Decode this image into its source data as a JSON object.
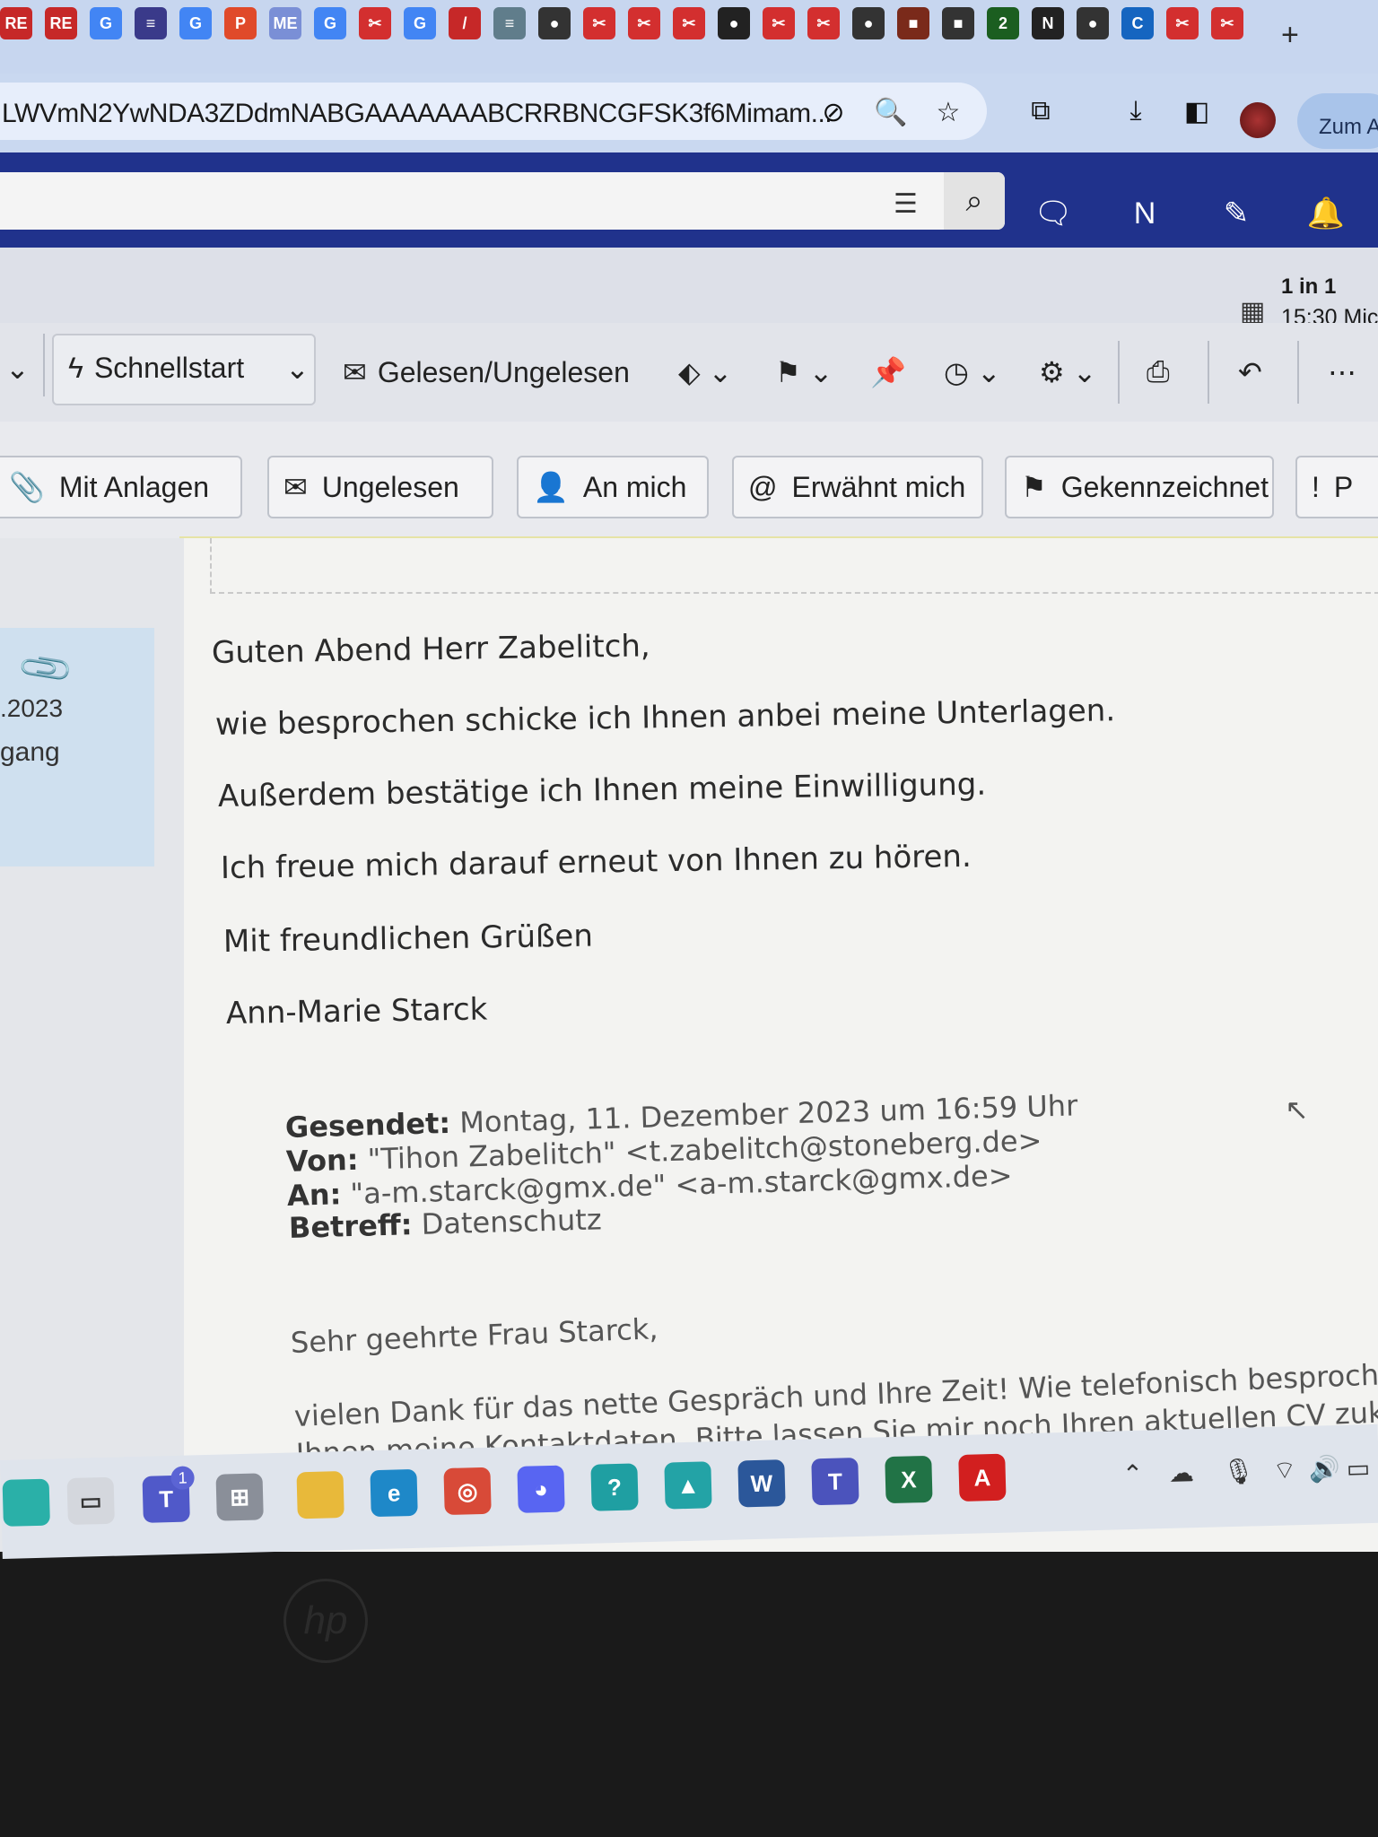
{
  "browser": {
    "tab_icons": [
      {
        "label": "RE",
        "color": "#c62828"
      },
      {
        "label": "RE",
        "color": "#c62828"
      },
      {
        "label": "G",
        "color": "#4285f4"
      },
      {
        "label": "≡",
        "color": "#3a3a8a"
      },
      {
        "label": "G",
        "color": "#4285f4"
      },
      {
        "label": "P",
        "color": "#e04a2a"
      },
      {
        "label": "ME",
        "color": "#7a8fd6"
      },
      {
        "label": "G",
        "color": "#4285f4"
      },
      {
        "label": "✂",
        "color": "#d32f2f"
      },
      {
        "label": "G",
        "color": "#4285f4"
      },
      {
        "label": "/",
        "color": "#c62828"
      },
      {
        "label": "≡",
        "color": "#607d8b"
      },
      {
        "label": "●",
        "color": "#333333"
      },
      {
        "label": "✂",
        "color": "#d32f2f"
      },
      {
        "label": "✂",
        "color": "#d32f2f"
      },
      {
        "label": "✂",
        "color": "#d32f2f"
      },
      {
        "label": "●",
        "color": "#222222"
      },
      {
        "label": "✂",
        "color": "#d32f2f"
      },
      {
        "label": "✂",
        "color": "#d32f2f"
      },
      {
        "label": "●",
        "color": "#333333"
      },
      {
        "label": "■",
        "color": "#7a2a1a"
      },
      {
        "label": "■",
        "color": "#333333"
      },
      {
        "label": "2",
        "color": "#1b5e20"
      },
      {
        "label": "N",
        "color": "#222222"
      },
      {
        "label": "●",
        "color": "#333333"
      },
      {
        "label": "C",
        "color": "#1565c0"
      },
      {
        "label": "✂",
        "color": "#d32f2f"
      },
      {
        "label": "✂",
        "color": "#d32f2f"
      }
    ],
    "new_tab": "+",
    "url": "LWVmN2YwNDA3ZDdmNABGAAAAAAABCRRBNCGFSK3f6Mimam...",
    "zum_button": "Zum A"
  },
  "outlook": {
    "meeting_line1": "1 in 1",
    "meeting_line2": "15:30 Mic",
    "ribbon": {
      "schnellstart": "Schnellstart",
      "gelesen": "Gelesen/Ungelesen"
    },
    "chips": {
      "mit_anlagen": "Mit Anlagen",
      "ungelesen": "Ungelesen",
      "an_mich": "An mich",
      "erwaehnt": "Erwähnt mich",
      "gekennzeichnet": "Gekennzeichnet",
      "p": "P"
    },
    "message_list": {
      "date": ".2023",
      "status": "gang"
    },
    "email": {
      "greeting": "Guten Abend Herr Zabelitch,",
      "line1": "wie besprochen schicke ich Ihnen anbei meine Unterlagen.",
      "line2": "Außerdem bestätige ich Ihnen meine Einwilligung.",
      "line3": "Ich freue mich darauf erneut von Ihnen zu hören.",
      "closing": "Mit freundlichen Grüßen",
      "signature": "Ann-Marie Starck",
      "quoted": {
        "sent_label": "Gesendet:",
        "sent_value": "Montag, 11. Dezember 2023 um 16:59 Uhr",
        "from_label": "Von:",
        "from_value": "\"Tihon Zabelitch\" <t.zabelitch@stoneberg.de>",
        "to_label": "An:",
        "to_value": "\"a-m.starck@gmx.de\" <a-m.starck@gmx.de>",
        "subject_label": "Betreff:",
        "subject_value": "Datenschutz",
        "salutation": "Sehr geehrte Frau Starck,",
        "body1": "vielen Dank für das nette Gespräch und Ihre Zeit! Wie telefonisch besprochen sen",
        "body2": "Ihnen meine Kontaktdaten. Bitte lassen Sie mir noch Ihren aktuellen CV zukomme"
      }
    }
  },
  "taskbar": {
    "apps": [
      {
        "name": "file-explorer-icon",
        "label": "",
        "color": "#e8b93a"
      },
      {
        "name": "edge-icon",
        "label": "e",
        "color": "#1e88c8"
      },
      {
        "name": "chrome-icon",
        "label": "◎",
        "color": "#d84a38"
      },
      {
        "name": "discord-icon",
        "label": "◕",
        "color": "#5865f2"
      },
      {
        "name": "help-icon",
        "label": "?",
        "color": "#1f9fa2"
      },
      {
        "name": "app-icon",
        "label": "▲",
        "color": "#23a3a6"
      },
      {
        "name": "word-icon",
        "label": "W",
        "color": "#2b579a"
      },
      {
        "name": "teams-new-icon",
        "label": "T",
        "color": "#4b53bc"
      },
      {
        "name": "excel-icon",
        "label": "X",
        "color": "#217346"
      },
      {
        "name": "acrobat-icon",
        "label": "A",
        "color": "#d21f1f"
      }
    ],
    "teams_badge": "1"
  },
  "laptop_logo": "hp"
}
